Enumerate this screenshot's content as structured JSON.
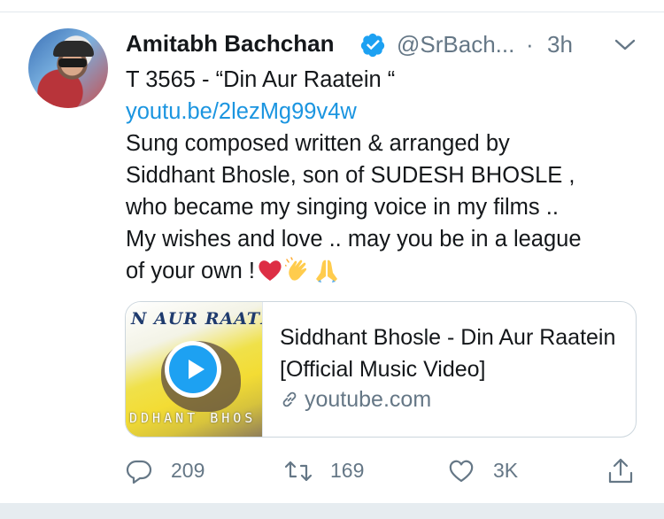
{
  "tweet": {
    "author_name": "Amitabh Bachchan",
    "handle": "@SrBach...",
    "separator": "·",
    "time": "3h",
    "lines": [
      "T 3565 - “Din Aur Raatein “",
      "youtu.be/2lezMg99v4w",
      "Sung composed written & arranged by",
      "Siddhant Bhosle, son of SUDESH BHOSLE ,",
      "who became my singing voice in my films ..",
      "My wishes and love .. may you be in a league",
      "of your own !"
    ],
    "emojis": [
      "red-heart-emoji",
      "clapping-hands-emoji",
      "folded-hands-emoji"
    ]
  },
  "card": {
    "thumbnail_top_text": "N AUR RAATE",
    "thumbnail_bottom_text": "DDHANT BHOS",
    "title": "Siddhant Bhosle - Din Aur Raatein [Official Music Video]",
    "domain": "youtube.com"
  },
  "actions": {
    "replies": "209",
    "retweets": "169",
    "likes": "3K"
  },
  "colors": {
    "link": "#1b95e0",
    "verified": "#1da1f2",
    "secondary_text": "#657786",
    "heart": "#e0245e"
  }
}
